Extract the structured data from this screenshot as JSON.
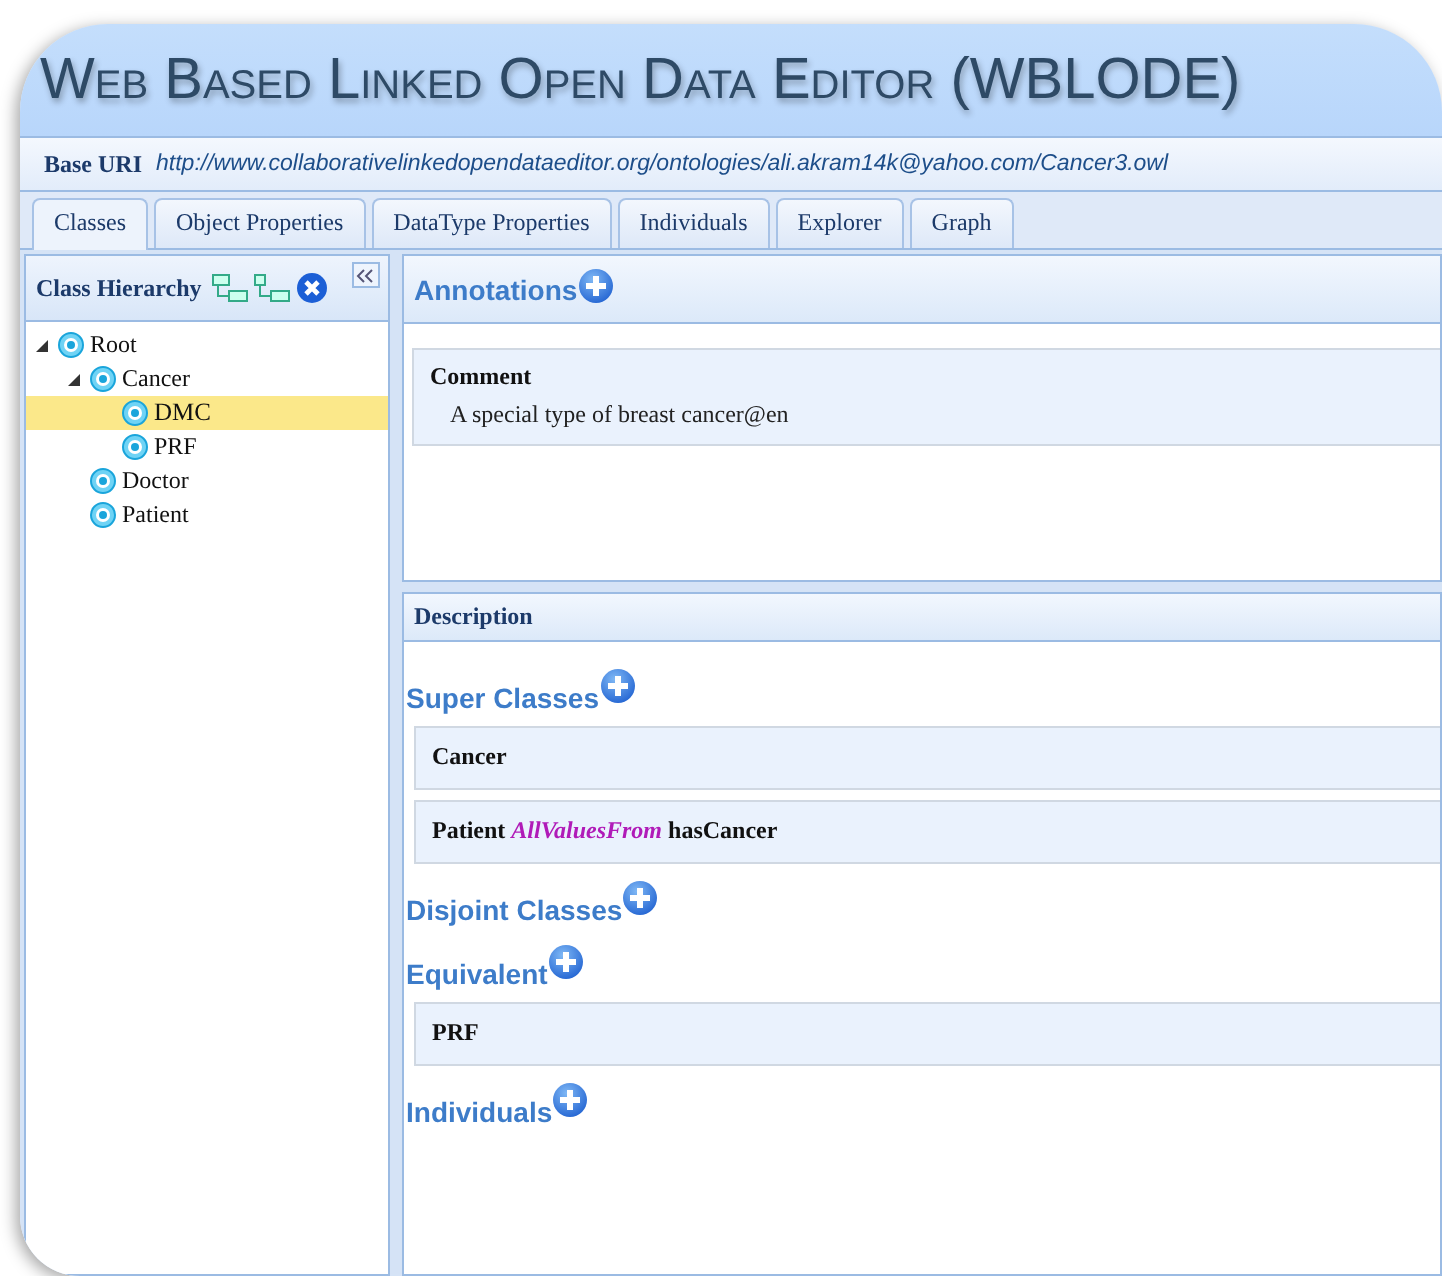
{
  "app_title": "Web Based Linked Open Data Editor (WBLODE)",
  "base_uri": {
    "label": "Base URI",
    "value": "http://www.collaborativelinkedopendataeditor.org/ontologies/ali.akram14k@yahoo.com/Cancer3.owl"
  },
  "tabs": [
    {
      "label": "Classes",
      "selected": true
    },
    {
      "label": "Object Properties",
      "selected": false
    },
    {
      "label": "DataType Properties",
      "selected": false
    },
    {
      "label": "Individuals",
      "selected": false
    },
    {
      "label": "Explorer",
      "selected": false
    },
    {
      "label": "Graph",
      "selected": false
    }
  ],
  "class_hierarchy": {
    "title": "Class Hierarchy",
    "tree": [
      {
        "label": "Root",
        "expanded": true,
        "selected": false,
        "children": [
          {
            "label": "Cancer",
            "expanded": true,
            "selected": false,
            "children": [
              {
                "label": "DMC",
                "selected": true
              },
              {
                "label": "PRF",
                "selected": false
              }
            ]
          },
          {
            "label": "Doctor",
            "selected": false
          },
          {
            "label": "Patient",
            "selected": false
          }
        ]
      }
    ]
  },
  "annotations": {
    "title": "Annotations",
    "entries": [
      {
        "label": "Comment",
        "value": "A special type of breast cancer@en"
      }
    ]
  },
  "description": {
    "title": "Description",
    "sections": [
      {
        "title": "Super Classes",
        "entries": [
          "Cancer",
          "Patient *AllValuesFrom* hasCancer"
        ]
      },
      {
        "title": "Disjoint Classes"
      },
      {
        "title": "Equivalent",
        "entries": [
          "PRF"
        ]
      },
      {
        "title": "Individuals"
      }
    ]
  }
}
